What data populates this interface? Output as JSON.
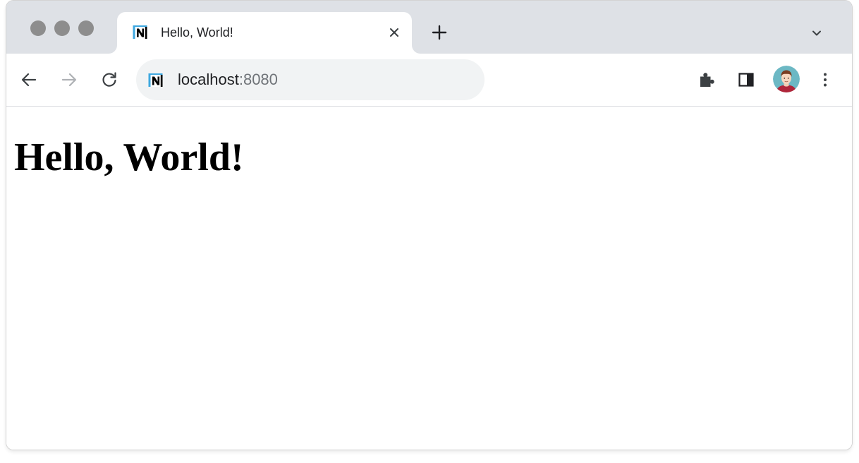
{
  "window": {
    "traffic_lights": [
      "close",
      "minimize",
      "maximize"
    ]
  },
  "tab": {
    "title": "Hello, World!",
    "favicon": "n-logo-icon",
    "close_icon": "close-icon"
  },
  "tabstrip": {
    "new_tab_icon": "plus-icon",
    "dropdown_icon": "chevron-down-icon"
  },
  "toolbar": {
    "back_icon": "arrow-left-icon",
    "forward_icon": "arrow-right-icon",
    "reload_icon": "reload-icon",
    "extensions_icon": "puzzle-piece-icon",
    "side_panel_icon": "side-panel-icon",
    "menu_icon": "three-dots-vertical-icon"
  },
  "omnibox": {
    "host": "localhost",
    "port": ":8080",
    "favicon": "n-logo-icon"
  },
  "page": {
    "heading": "Hello, World!"
  },
  "colors": {
    "tabstrip_bg": "#dee1e6",
    "omnibox_bg": "#f1f3f4",
    "favicon_accent": "#3ea8e0",
    "traffic_light": "#8d8d8d",
    "avatar_bg": "#6cb8c4",
    "avatar_shirt": "#b0263a"
  }
}
